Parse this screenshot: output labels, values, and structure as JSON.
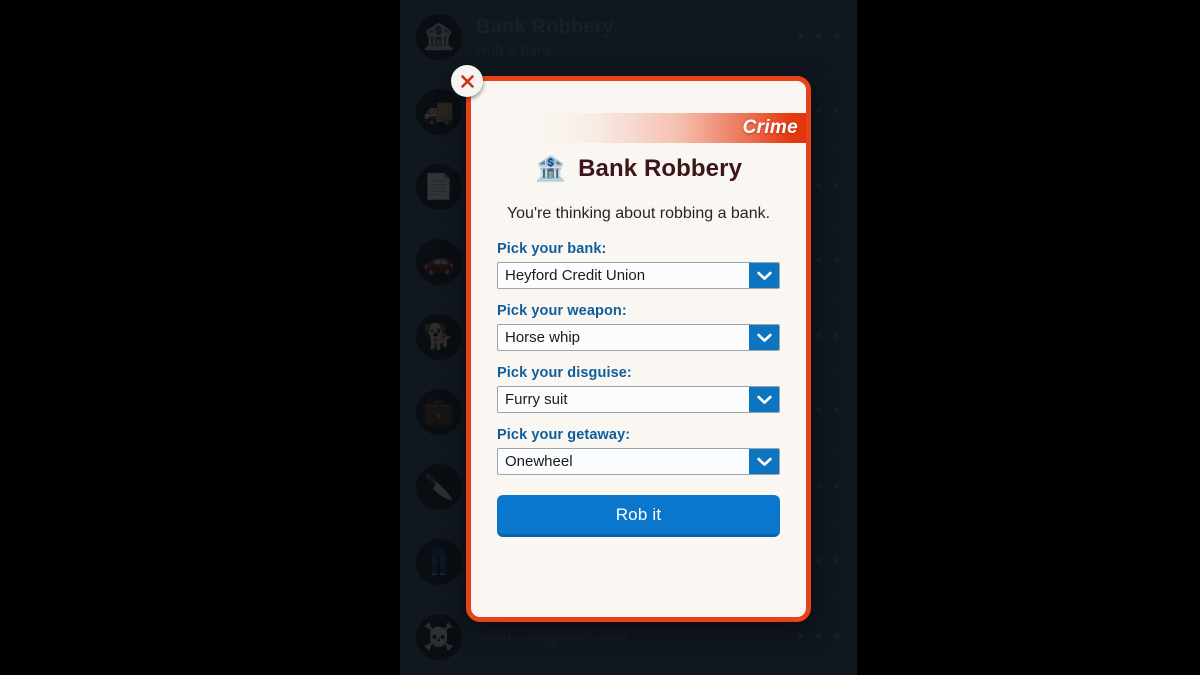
{
  "background": {
    "rows": [
      {
        "icon": "🏦",
        "icon_name": "bank-icon",
        "title": "Bank Robbery",
        "subtitle": "Rob a bank",
        "menu": "• • •"
      },
      {
        "icon": "🚚",
        "icon_name": "truck-icon",
        "title": "",
        "subtitle": "",
        "menu": "• • •"
      },
      {
        "icon": "📄",
        "icon_name": "document-icon",
        "title": "",
        "subtitle": "",
        "menu": "• • •"
      },
      {
        "icon": "🚗",
        "icon_name": "car-icon",
        "title": "",
        "subtitle": "",
        "menu": "• • •"
      },
      {
        "icon": "🐕",
        "icon_name": "dog-icon",
        "title": "",
        "subtitle": "",
        "menu": "• • •"
      },
      {
        "icon": "💼",
        "icon_name": "briefcase-icon",
        "title": "",
        "subtitle": "",
        "menu": "• • •"
      },
      {
        "icon": "🔪",
        "icon_name": "knife-icon",
        "title": "",
        "subtitle": "",
        "menu": "• • •"
      },
      {
        "icon": "👖",
        "icon_name": "jeans-icon",
        "title": "",
        "subtitle": "",
        "menu": "• • •"
      },
      {
        "icon": "☠️",
        "icon_name": "skull-icon",
        "title": "",
        "subtitle": "Steal a neighbor's mail",
        "menu": "• • •"
      }
    ]
  },
  "modal": {
    "close_label": "close-icon",
    "ribbon_label": "Crime",
    "title_icon": "🏦",
    "title": "Bank Robbery",
    "description": "You're thinking about robbing a bank.",
    "fields": [
      {
        "label": "Pick your bank:",
        "value": "Heyford Credit Union"
      },
      {
        "label": "Pick your weapon:",
        "value": "Horse whip"
      },
      {
        "label": "Pick your disguise:",
        "value": "Furry suit"
      },
      {
        "label": "Pick your getaway:",
        "value": "Onewheel"
      }
    ],
    "submit_label": "Rob it",
    "colors": {
      "border": "#e8421a",
      "ribbon": "#e03209",
      "label_blue": "#0d5e9e",
      "accent_blue": "#0b77cc",
      "title_maroon": "#3b1519",
      "panel": "#faf7f2"
    }
  }
}
